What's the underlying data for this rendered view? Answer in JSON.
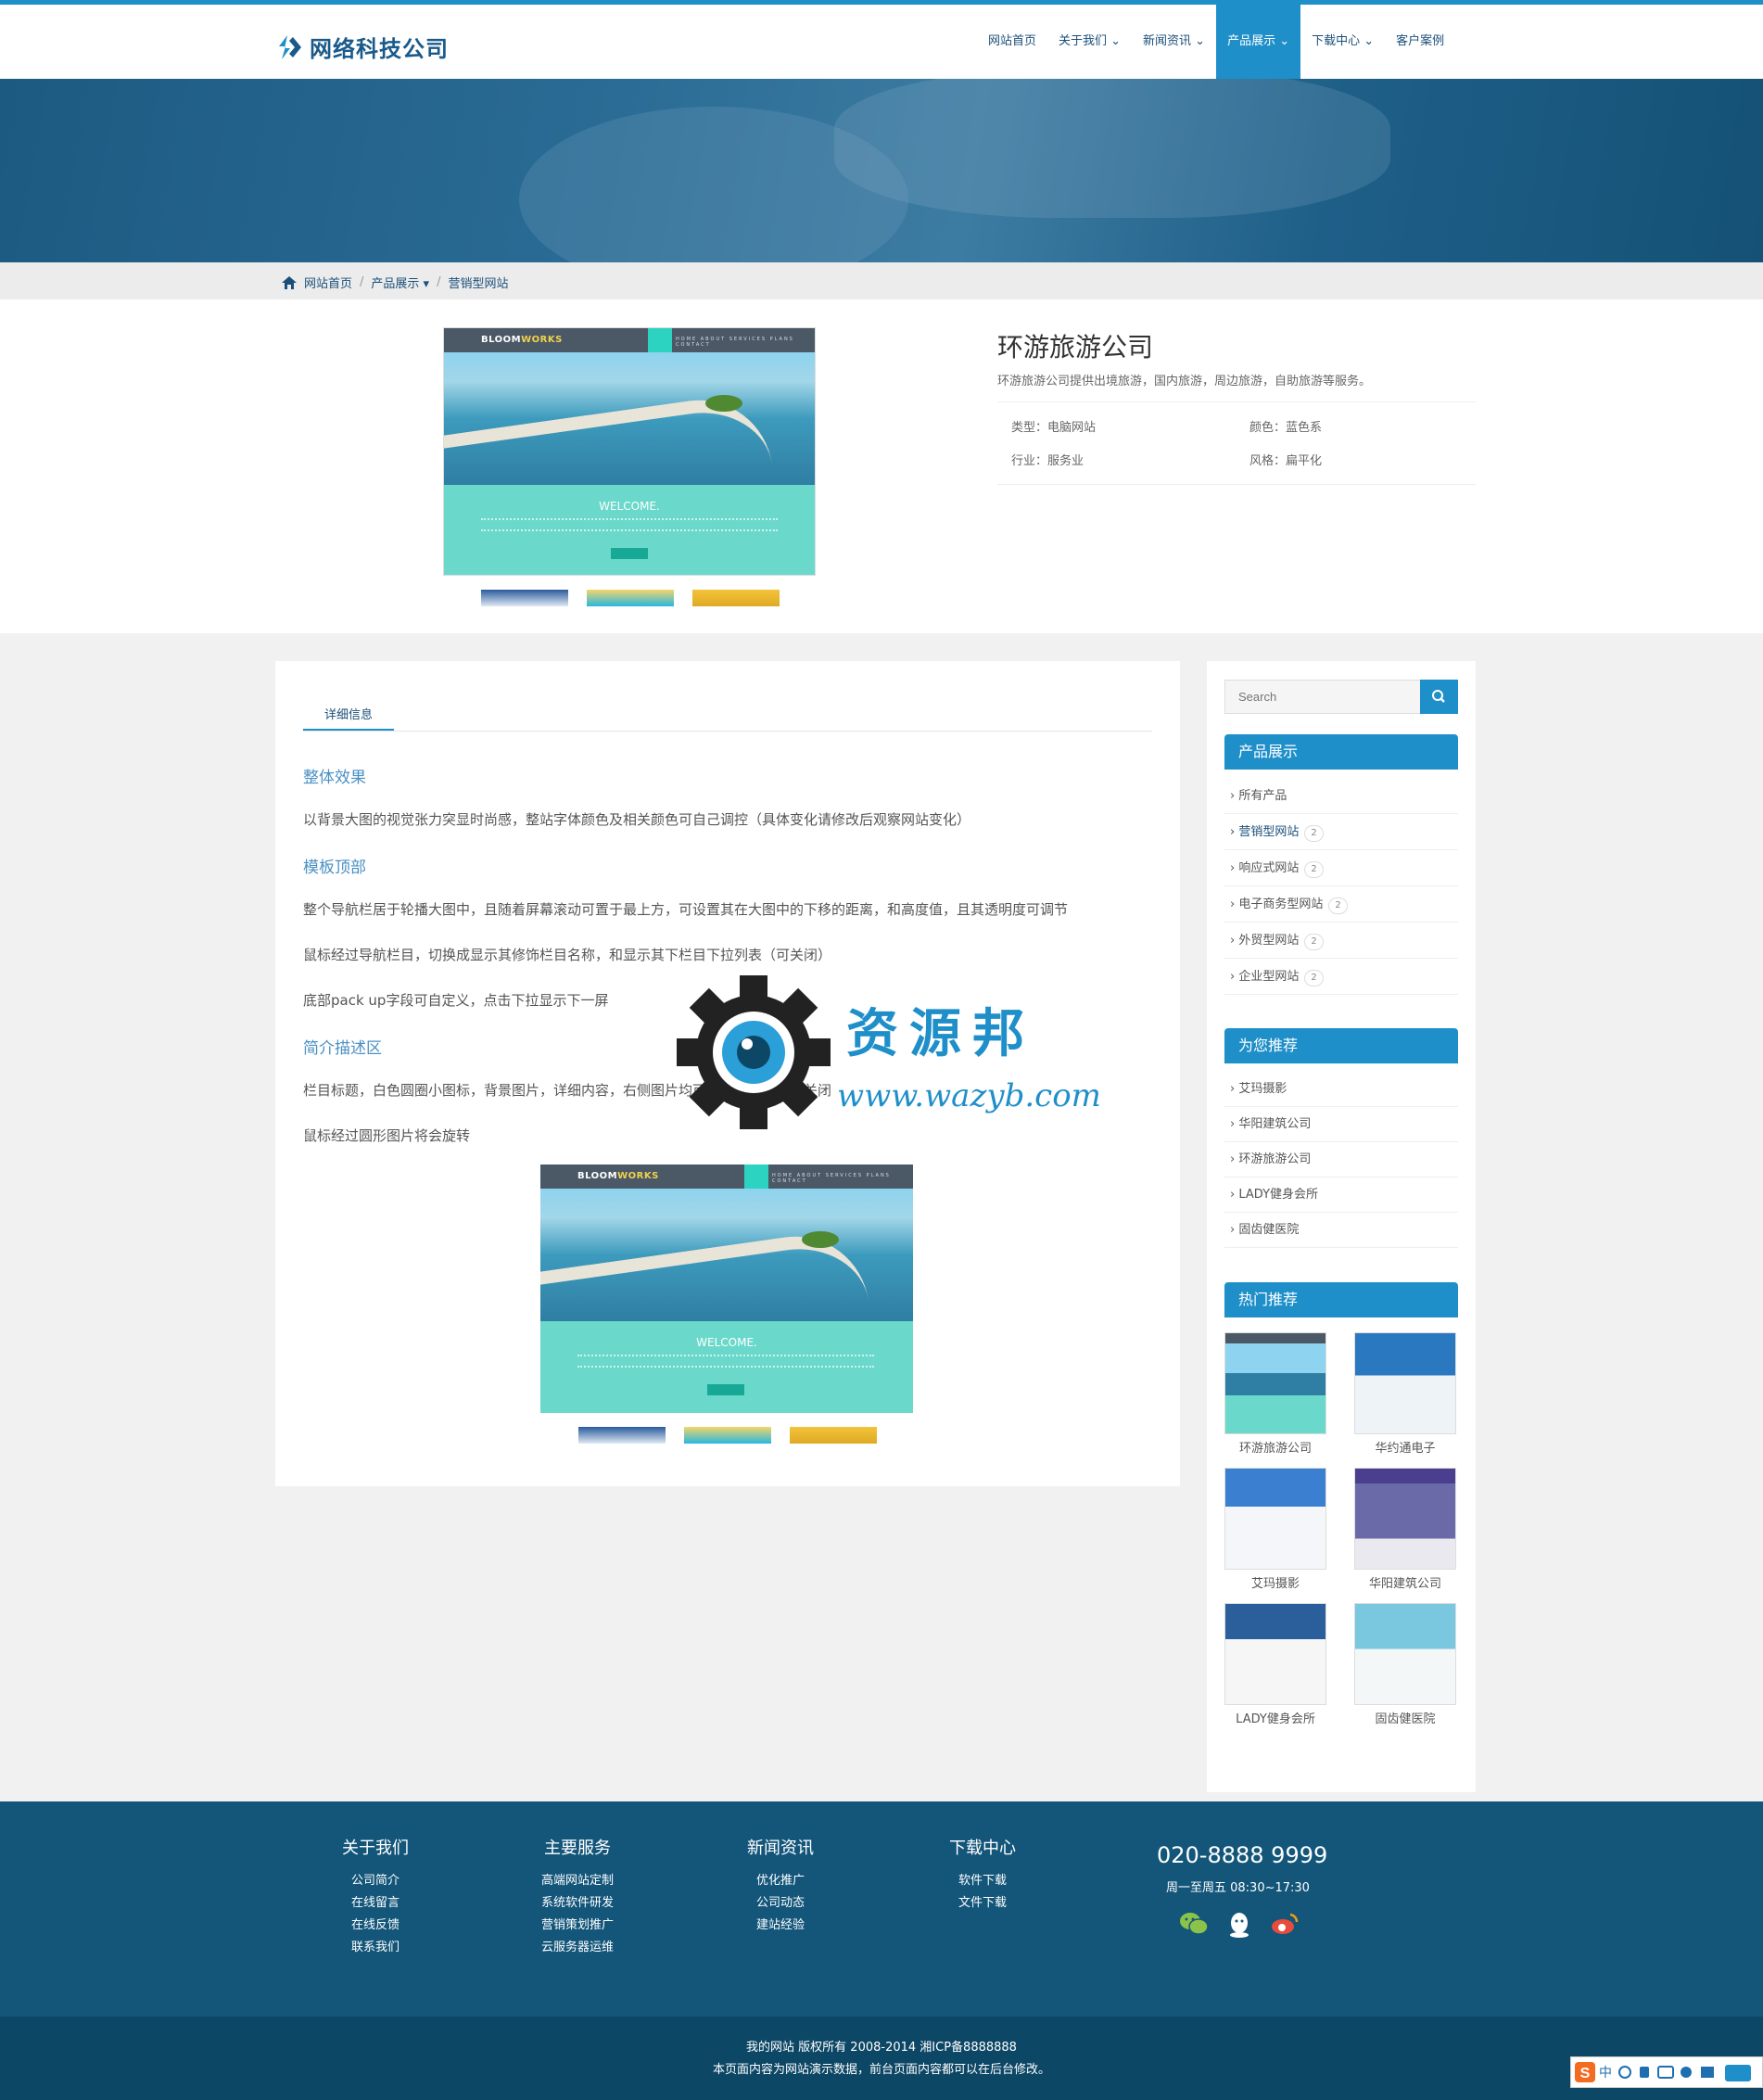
{
  "header": {
    "logo_text": "网络科技公司",
    "nav": [
      {
        "label": "网站首页"
      },
      {
        "label": "关于我们 ⌄"
      },
      {
        "label": "新闻资讯 ⌄"
      },
      {
        "label": "产品展示 ⌄",
        "active": true
      },
      {
        "label": "下载中心 ⌄"
      },
      {
        "label": "客户案例"
      }
    ]
  },
  "breadcrumb": {
    "home": "网站首页",
    "sep": "/",
    "level2": "产品展示 ▾",
    "current": "营销型网站"
  },
  "product": {
    "title": "环游旅游公司",
    "desc": "环游旅游公司提供出境旅游，国内旅游，周边旅游，自助旅游等服务。",
    "meta": {
      "type": "类型：电脑网站",
      "color": "颜色：蓝色系",
      "industry": "行业：服务业",
      "style": "风格：扁平化"
    },
    "screenshot": {
      "brand_a": "BLOOM",
      "brand_b": "WORKS",
      "nav": "HOME ABOUT SERVICES PLANS CONTACT",
      "welcome": "WELCOME."
    }
  },
  "detail": {
    "tab": "详细信息",
    "sections": [
      {
        "heading": "整体效果"
      },
      {
        "text": "以背景大图的视觉张力突显时尚感，整站字体颜色及相关颜色可自己调控（具体变化请修改后观察网站变化）"
      },
      {
        "heading": "模板顶部"
      },
      {
        "text": "整个导航栏居于轮播大图中，且随着屏幕滚动可置于最上方，可设置其在大图中的下移的距离，和高度值，且其透明度可调节"
      },
      {
        "text": "鼠标经过导航栏目，切换成显示其修饰栏目名称，和显示其下栏目下拉列表（可关闭）"
      },
      {
        "text": "底部pack up字段可自定义，点击下拉显示下一屏"
      },
      {
        "heading": "简介描述区"
      },
      {
        "text": "栏目标题，白色圆圈小图标，背景图片，详细内容，右侧图片均可自定义，模块可关闭"
      },
      {
        "text": "鼠标经过圆形图片将会旋转"
      }
    ]
  },
  "sidebar": {
    "search_placeholder": "Search",
    "cat_title": "产品展示",
    "categories": [
      {
        "label": "› 所有产品",
        "count": ""
      },
      {
        "label": "› 营销型网站",
        "count": "2"
      },
      {
        "label": "› 响应式网站",
        "count": "2"
      },
      {
        "label": "› 电子商务型网站",
        "count": "2"
      },
      {
        "label": "› 外贸型网站",
        "count": "2"
      },
      {
        "label": "› 企业型网站",
        "count": "2"
      }
    ],
    "rec_title": "为您推荐",
    "recommended": [
      "› 艾玛摄影",
      "› 华阳建筑公司",
      "› 环游旅游公司",
      "› LADY健身会所",
      "› 固齿健医院"
    ],
    "hot_title": "热门推荐",
    "hot": [
      "环游旅游公司",
      "华约通电子",
      "艾玛摄影",
      "华阳建筑公司",
      "LADY健身会所",
      "固齿健医院"
    ]
  },
  "footer": {
    "cols": [
      {
        "title": "关于我们",
        "links": [
          "公司简介",
          "在线留言",
          "在线反馈",
          "联系我们"
        ]
      },
      {
        "title": "主要服务",
        "links": [
          "高端网站定制",
          "系统软件研发",
          "营销策划推广",
          "云服务器运维"
        ]
      },
      {
        "title": "新闻资讯",
        "links": [
          "优化推广",
          "公司动态",
          "建站经验"
        ]
      },
      {
        "title": "下载中心",
        "links": [
          "软件下载",
          "文件下载"
        ]
      }
    ],
    "phone": "020-8888 9999",
    "hours": "周一至周五 08:30~17:30",
    "copyright": "我的网站 版权所有 2008-2014 湘ICP备8888888",
    "notice": "本页面内容为网站演示数据，前台页面内容都可以在后台修改。"
  },
  "watermark": {
    "title": "资源邦",
    "url": "www.wazyb.com"
  },
  "ime": {
    "label": "中"
  },
  "colors": {
    "accent": "#1f8fc9",
    "footer": "#13567a",
    "footer_bottom": "#0d4766"
  }
}
